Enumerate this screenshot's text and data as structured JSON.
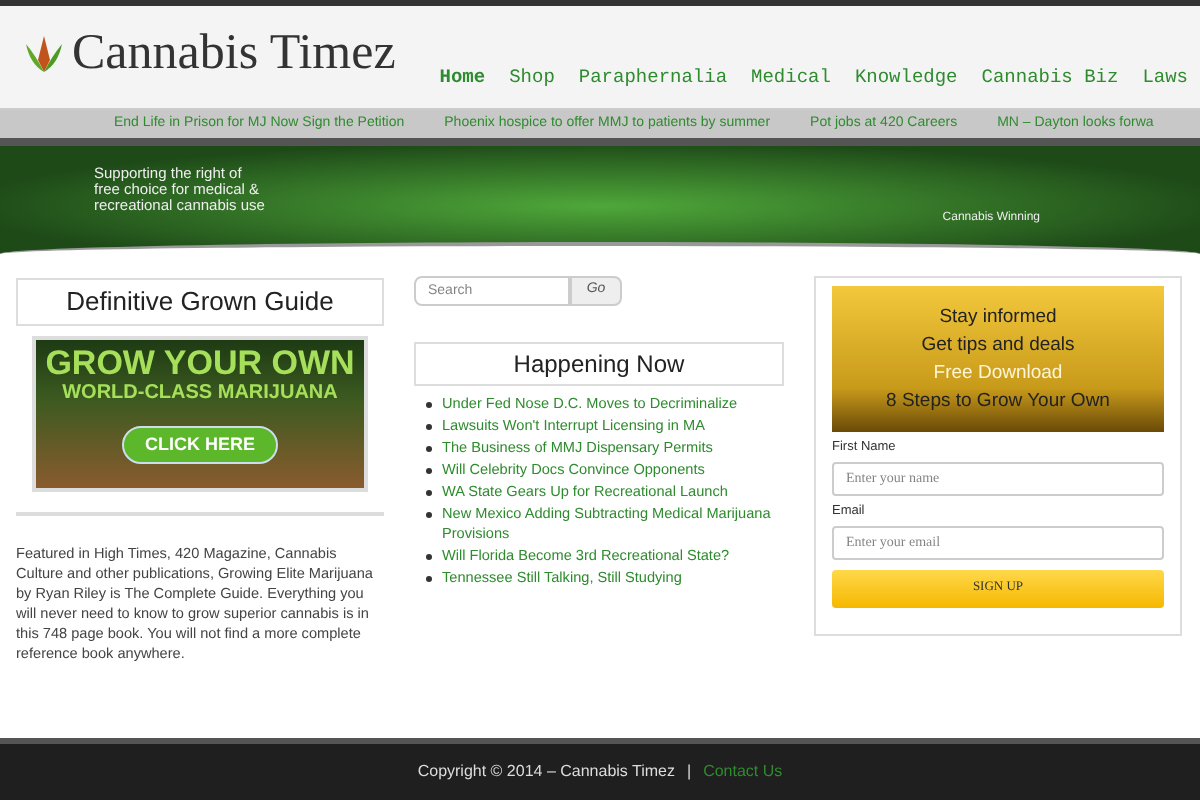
{
  "header": {
    "logo_text": "Cannabis Timez",
    "nav": [
      {
        "label": "Home",
        "selected": true
      },
      {
        "label": "Shop",
        "selected": false
      },
      {
        "label": "Paraphernalia",
        "selected": false
      },
      {
        "label": "Medical",
        "selected": false
      },
      {
        "label": "Knowledge",
        "selected": false
      },
      {
        "label": "Cannabis Biz",
        "selected": false
      },
      {
        "label": "Laws",
        "selected": false
      }
    ]
  },
  "ticker": [
    "End Life in Prison for MJ Now Sign the Petition",
    "Phoenix hospice to offer MMJ to patients by summer",
    "Pot jobs at 420 Careers",
    "MN – Dayton looks forwa"
  ],
  "hero": {
    "tagline": [
      "Supporting the right of",
      "free choice for medical &",
      "recreational cannabis use"
    ],
    "caption": "Cannabis Winning"
  },
  "left": {
    "title": "Definitive Grown Guide",
    "ad": {
      "headline": "GROW YOUR OWN",
      "subline": "WORLD-CLASS MARIJUANA",
      "button": "CLICK HERE"
    },
    "description": "Featured in High Times, 420 Magazine, Cannabis Culture and other publications, Growing Elite Marijuana by Ryan Riley is The Complete Guide. Everything you will never need to know to grow superior cannabis is in this 748 page book. You will not find a more complete reference book anywhere."
  },
  "middle": {
    "search": {
      "placeholder": "Search",
      "button": "Go"
    },
    "title": "Happening Now",
    "links": [
      "Under Fed Nose D.C. Moves to Decriminalize",
      "Lawsuits Won't Interrupt Licensing in MA",
      "The Business of MMJ Dispensary Permits",
      "Will Celebrity Docs Convince Opponents",
      "WA State Gears Up for Recreational Launch",
      "New Mexico Adding Subtracting Medical Marijuana Provisions",
      "Will Florida Become 3rd Recreational State?",
      "Tennessee Still Talking, Still Studying"
    ]
  },
  "right": {
    "promo": [
      {
        "text": "Stay informed",
        "kind": "dark"
      },
      {
        "text": "Get tips and deals",
        "kind": "dark"
      },
      {
        "text": "Free Download",
        "kind": "light"
      },
      {
        "text": "8 Steps to Grow Your Own",
        "kind": "dark"
      }
    ],
    "fields": [
      {
        "label": "First Name",
        "placeholder": "Enter your name"
      },
      {
        "label": "Email",
        "placeholder": "Enter your email"
      }
    ],
    "button": "SIGN UP"
  },
  "footer": {
    "copyright": "Copyright © 2014 – Cannabis Timez",
    "separator": "|",
    "link": "Contact Us"
  }
}
